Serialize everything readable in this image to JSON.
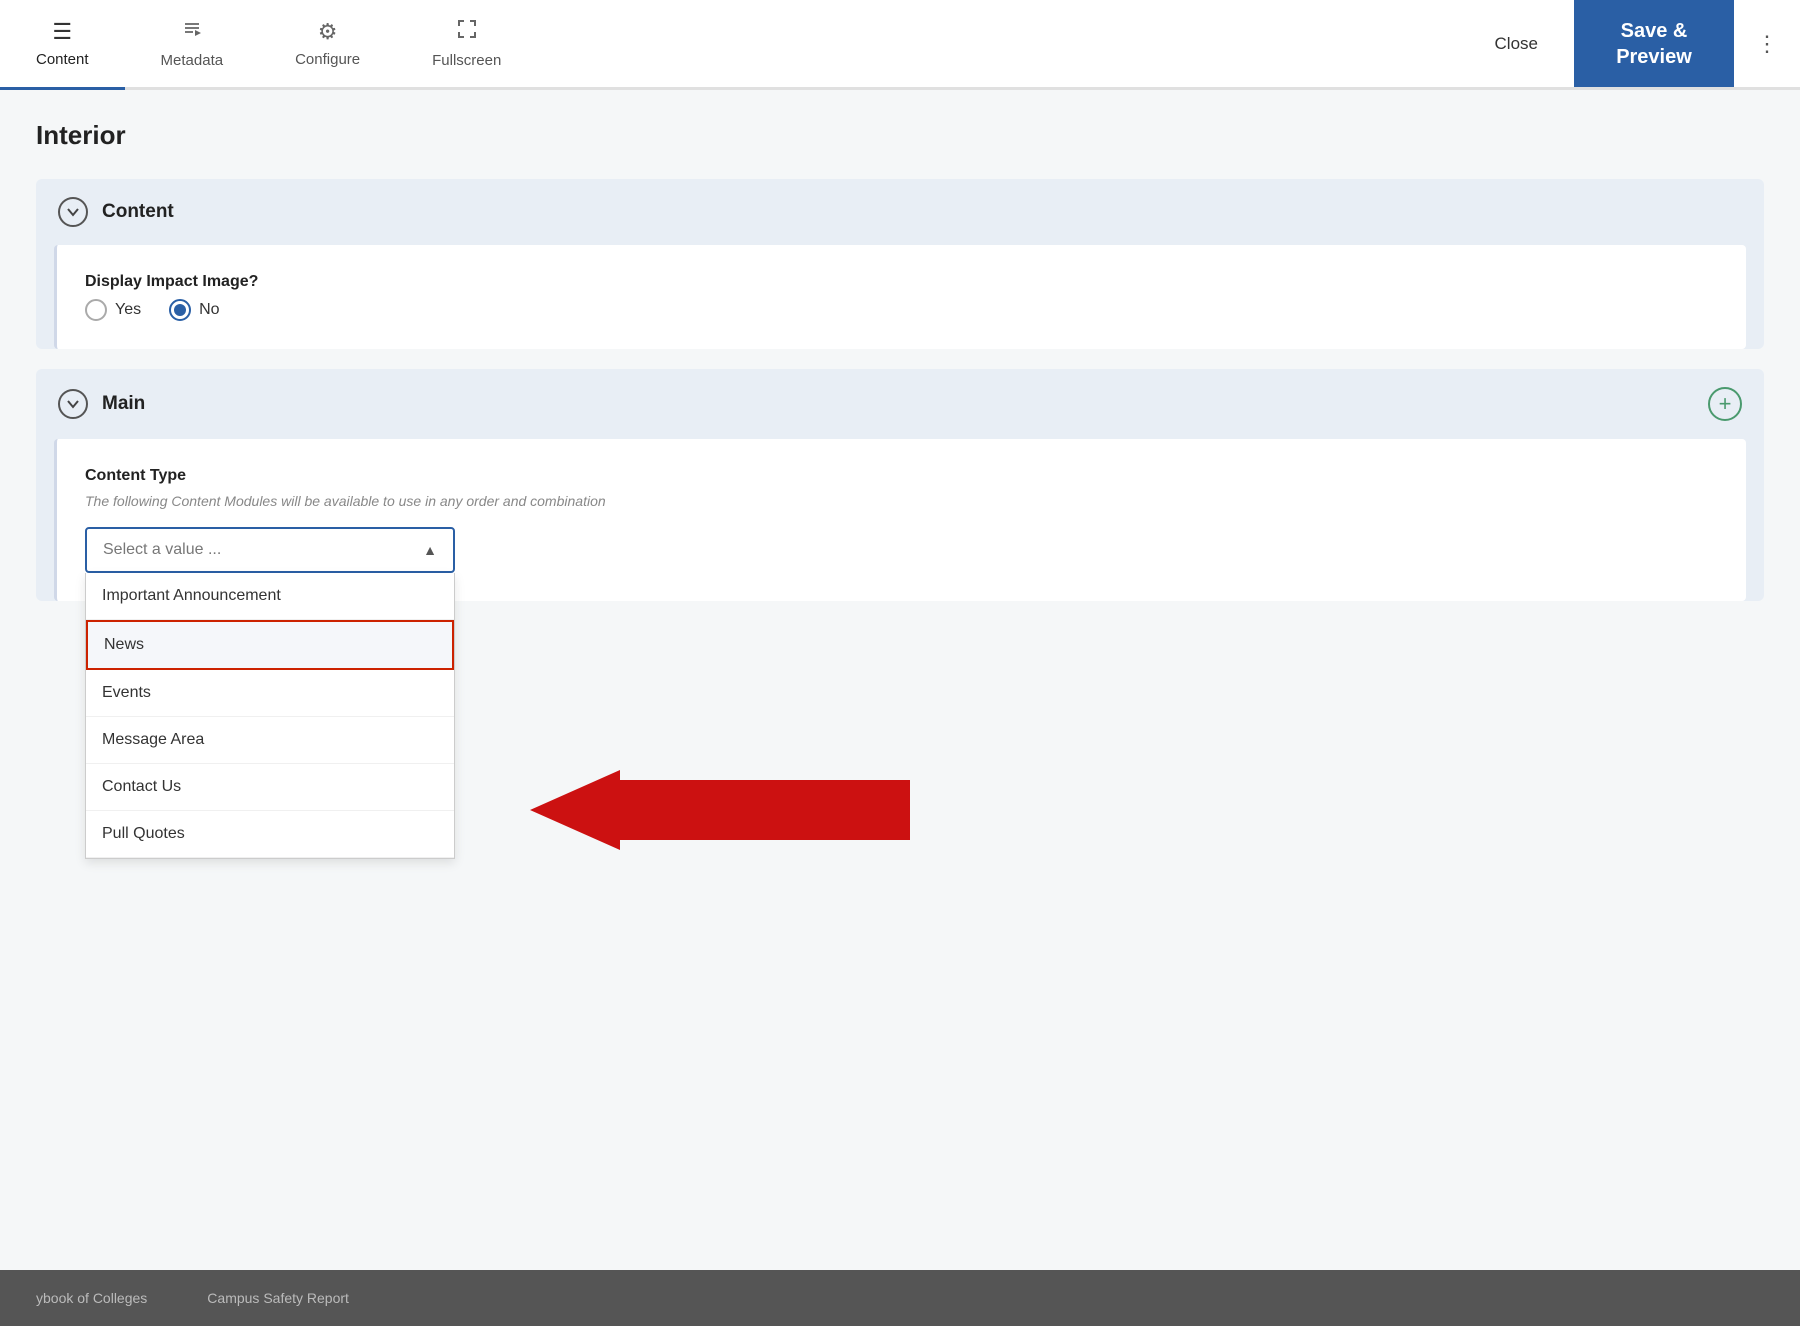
{
  "nav": {
    "tabs": [
      {
        "id": "content",
        "label": "Content",
        "icon": "☰",
        "active": true
      },
      {
        "id": "metadata",
        "label": "Metadata",
        "icon": "🏷",
        "active": false
      },
      {
        "id": "configure",
        "label": "Configure",
        "icon": "⚙",
        "active": false
      },
      {
        "id": "fullscreen",
        "label": "Fullscreen",
        "icon": "⛶",
        "active": false
      }
    ],
    "close_label": "Close",
    "save_label": "Save &\nPreview",
    "more_icon": "⋮"
  },
  "page": {
    "title": "Interior"
  },
  "content_section": {
    "title": "Content",
    "display_impact_label": "Display Impact Image?",
    "radio_yes": "Yes",
    "radio_no": "No",
    "radio_selected": "no"
  },
  "main_section": {
    "title": "Main",
    "content_type_label": "Content Type",
    "content_type_hint": "The following Content Modules will be available to use in any order and combination",
    "dropdown_placeholder": "Select a value ...",
    "dropdown_options": [
      {
        "id": "important_announcement",
        "label": "Important Announcement"
      },
      {
        "id": "news",
        "label": "News",
        "highlighted": true
      },
      {
        "id": "events",
        "label": "Events"
      },
      {
        "id": "message_area",
        "label": "Message Area"
      },
      {
        "id": "contact_us",
        "label": "Contact Us"
      },
      {
        "id": "pull_quotes",
        "label": "Pull Quotes"
      }
    ]
  },
  "footer": {
    "links": [
      "ybook of Colleges",
      "Campus Safety Report"
    ]
  }
}
